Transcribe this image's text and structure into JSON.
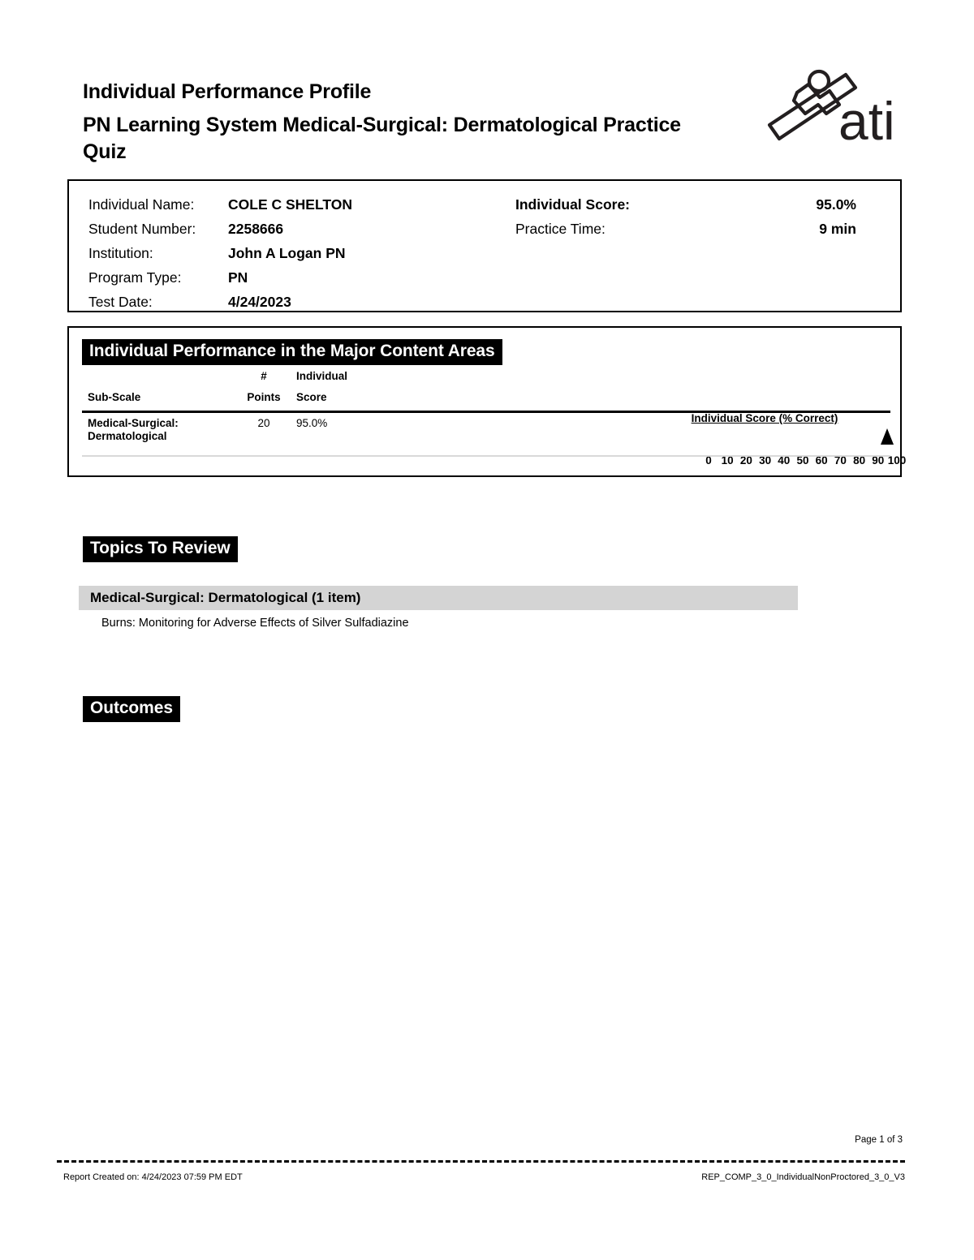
{
  "document": {
    "title": "Individual Performance Profile",
    "subtitle": "PN Learning System Medical-Surgical: Dermatological Practice Quiz",
    "logo_alt": "ati-logo",
    "logo_wordmark": "ati"
  },
  "info": {
    "left": [
      {
        "label": "Individual Name:",
        "value": "COLE C SHELTON"
      },
      {
        "label": "Student Number:",
        "value": "2258666"
      },
      {
        "label": "Institution:",
        "value": "John A Logan PN"
      },
      {
        "label": "Program Type:",
        "value": "PN"
      },
      {
        "label": "Test Date:",
        "value": "4/24/2023"
      }
    ],
    "right": [
      {
        "label": "Individual Score:",
        "value": "95.0%"
      },
      {
        "label": "Practice Time:",
        "value": "9 min"
      }
    ]
  },
  "content_areas": {
    "band_title": "Individual Performance in the Major Content Areas",
    "headers": {
      "sub_scale": "Sub-Scale",
      "points_top": "#",
      "points_bottom": "Points",
      "score_top": "Individual",
      "score_bottom": "Score"
    },
    "scale_caption": "Individual Score (% Correct)",
    "rows": [
      {
        "sub_scale_line1": "Medical-Surgical:",
        "sub_scale_line2": "Dermatological",
        "points": "20",
        "score": "95.0%",
        "marker_value": 95
      }
    ]
  },
  "chart_data": {
    "type": "bar",
    "title": "Individual Score (% Correct)",
    "categories": [
      "Medical-Surgical: Dermatological"
    ],
    "values": [
      95.0
    ],
    "points": [
      20
    ],
    "xlabel": "Individual Score (% Correct)",
    "ylabel": "",
    "xlim": [
      0,
      100
    ],
    "ticks": [
      0,
      10,
      20,
      30,
      40,
      50,
      60,
      70,
      80,
      90,
      100
    ],
    "tick_labels": [
      "0",
      "10",
      "20",
      "30",
      "40",
      "50",
      "60",
      "70",
      "80",
      "90",
      "100"
    ],
    "grid": false,
    "legend": "none",
    "marker_style": "filled-triangle"
  },
  "topics": {
    "section_title": "Topics To Review",
    "groups": [
      {
        "header": "Medical-Surgical: Dermatological (1 item)",
        "items": [
          "Burns: Monitoring for Adverse Effects of Silver Sulfadiazine"
        ]
      }
    ]
  },
  "outcomes": {
    "section_title": "Outcomes"
  },
  "footer": {
    "page_number": "Page 1 of 3",
    "created": "Report Created on: 4/24/2023 07:59 PM EDT",
    "report_code": "REP_COMP_3_0_IndividualNonProctored_3_0_V3"
  },
  "colors": {
    "band": "#000000",
    "band_text": "#ffffff",
    "group_header_bg": "#d4d4d4",
    "rule_light": "#d9d9d9"
  }
}
